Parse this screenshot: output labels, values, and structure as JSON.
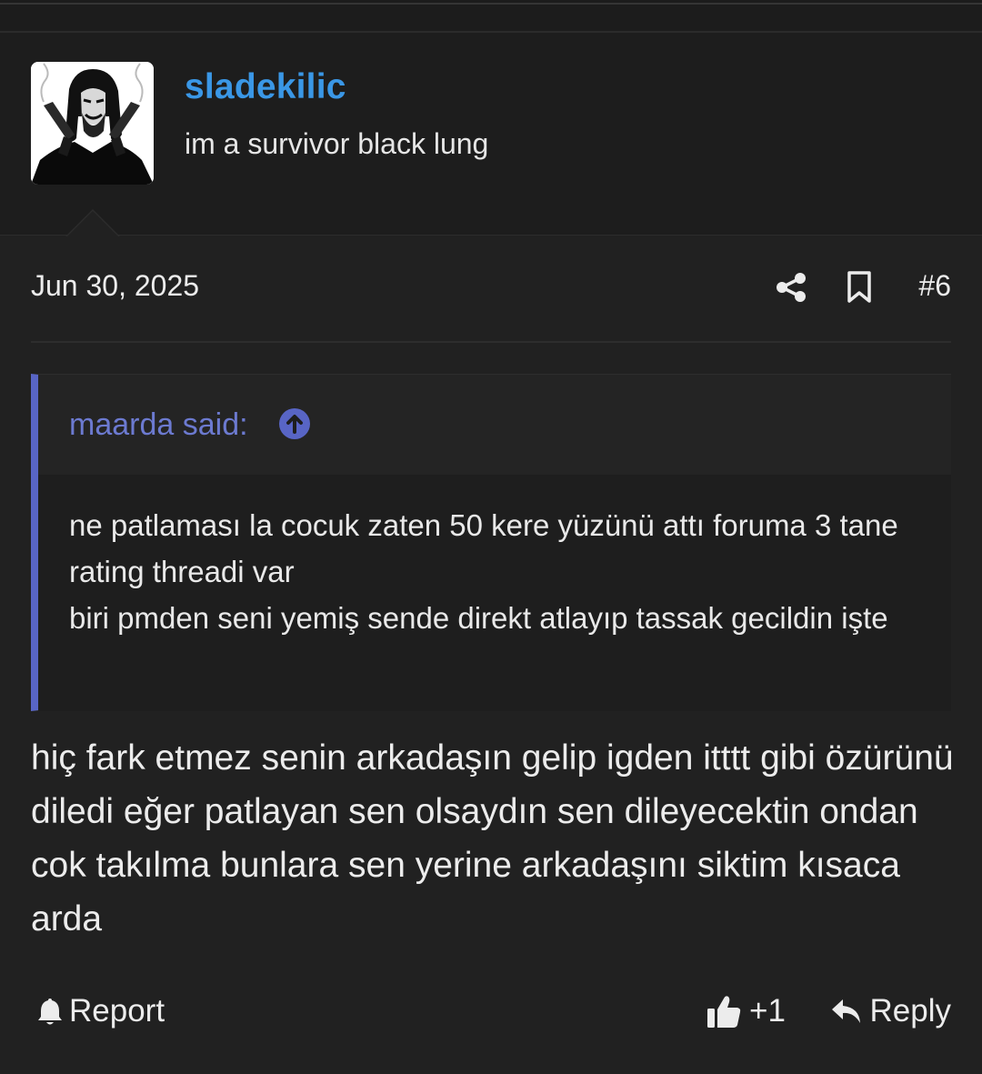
{
  "author": {
    "username": "sladekilic",
    "title": "im a survivor black lung"
  },
  "post": {
    "date": "Jun 30, 2025",
    "number": "#6",
    "body": "hiç fark etmez senin arkadaşın gelip igden itttt gibi özürünü diledi eğer patlayan sen olsaydın sen dileyecektin ondan cok takılma bunlara sen yerine arkadaşını siktim kısaca arda"
  },
  "quote": {
    "author_label": "maarda said:",
    "lines": [
      "ne patlaması la cocuk zaten 50 kere yüzünü attı foruma 3 tane rating threadi var",
      "biri pmden seni yemiş sende direkt atlayıp tassak gecildin işte"
    ]
  },
  "actions": {
    "report_label": "Report",
    "like_count": "+1",
    "reply_label": "Reply"
  },
  "icons": {
    "share": "share-icon",
    "bookmark": "bookmark-icon",
    "quote_jump": "arrow-up-circle-icon",
    "report": "bell-icon",
    "like": "thumbs-up-icon",
    "reply": "reply-arrow-icon"
  },
  "colors": {
    "background": "#212121",
    "username": "#3a97e6",
    "quote_accent": "#5865c5",
    "quote_author": "#6c7ad0"
  }
}
